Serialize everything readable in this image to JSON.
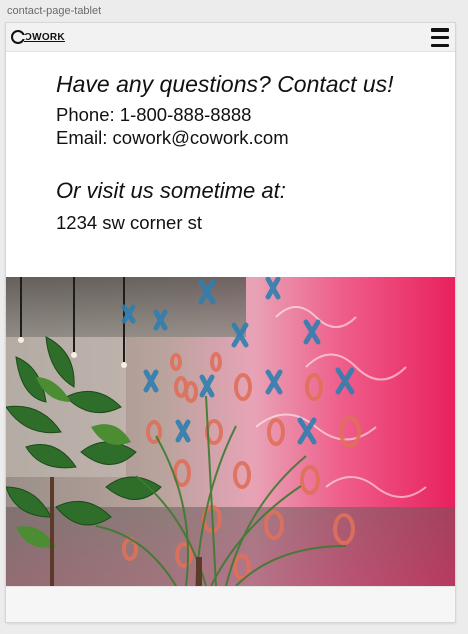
{
  "frame": {
    "label": "contact-page-tablet"
  },
  "navbar": {
    "logo_text": "OWORK"
  },
  "contact": {
    "heading": "Have any questions? Contact us!",
    "phone": "Phone: 1-800-888-8888",
    "email": "Email: cowork@cowork.com",
    "visit_heading": "Or visit us sometime at:",
    "address": "1234 sw corner st"
  },
  "colors": {
    "x_marks": "#2f7fb0",
    "o_marks": "#e0705a",
    "wall_pink": "#e8447a",
    "plant_green": "#2f6d2a"
  }
}
